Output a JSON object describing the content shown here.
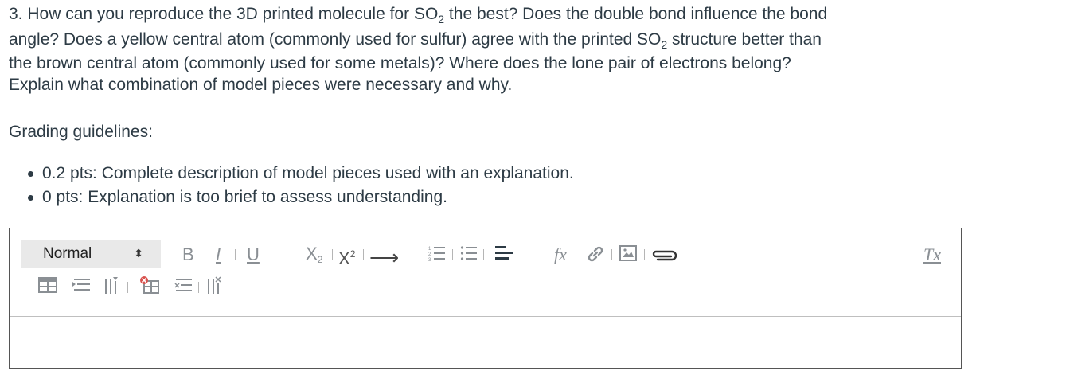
{
  "question": {
    "line1_a": "3. How can you reproduce the 3D printed molecule for SO",
    "line1_sub": "2",
    "line1_b": " the best? Does the double bond influence the bond",
    "line2_a": "angle? Does a yellow central atom (commonly used for sulfur) agree with the printed SO",
    "line2_sub": "2",
    "line2_b": " structure better than",
    "line3": "the brown central atom (commonly used for some metals)? Where does the lone pair of electrons belong?",
    "line4": "Explain what combination of model pieces were necessary and why."
  },
  "grading": {
    "heading": "Grading guidelines:",
    "items": [
      "0.2 pts: Complete description of model pieces used with an explanation.",
      "0 pts: Explanation is too brief to assess understanding."
    ]
  },
  "editor": {
    "format_select": "Normal",
    "format_arrows": "⬍",
    "bold": "B",
    "italic": "I",
    "underline": "U",
    "subscript_base": "X",
    "subscript_mark": "2",
    "superscript_base": "X",
    "superscript_mark": "2",
    "arrow": "⟶",
    "formula": "fx",
    "clear_format": "Tx"
  },
  "icons": {
    "text_color": "#8a8f94",
    "dark_color": "#2d3b45",
    "remove_red": "#d9534f"
  }
}
